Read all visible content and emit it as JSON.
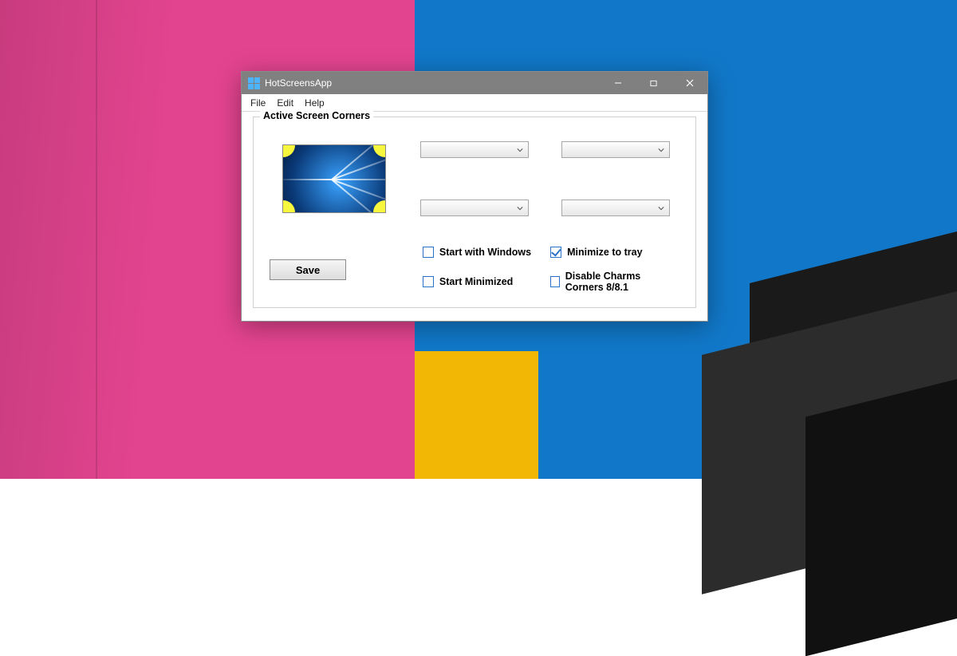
{
  "window": {
    "title": "HotScreensApp"
  },
  "menu": {
    "file": "File",
    "edit": "Edit",
    "help": "Help"
  },
  "group": {
    "title": "Active Screen Corners"
  },
  "corners": {
    "top_left": "",
    "top_right": "",
    "bottom_left": "",
    "bottom_right": ""
  },
  "options": {
    "start_with_windows": {
      "label": "Start with Windows",
      "checked": false
    },
    "start_minimized": {
      "label": "Start Minimized",
      "checked": false
    },
    "minimize_to_tray": {
      "label": "Minimize to tray",
      "checked": true
    },
    "disable_charms": {
      "label": "Disable Charms Corners 8/8.1",
      "checked": false
    }
  },
  "buttons": {
    "save": "Save"
  }
}
